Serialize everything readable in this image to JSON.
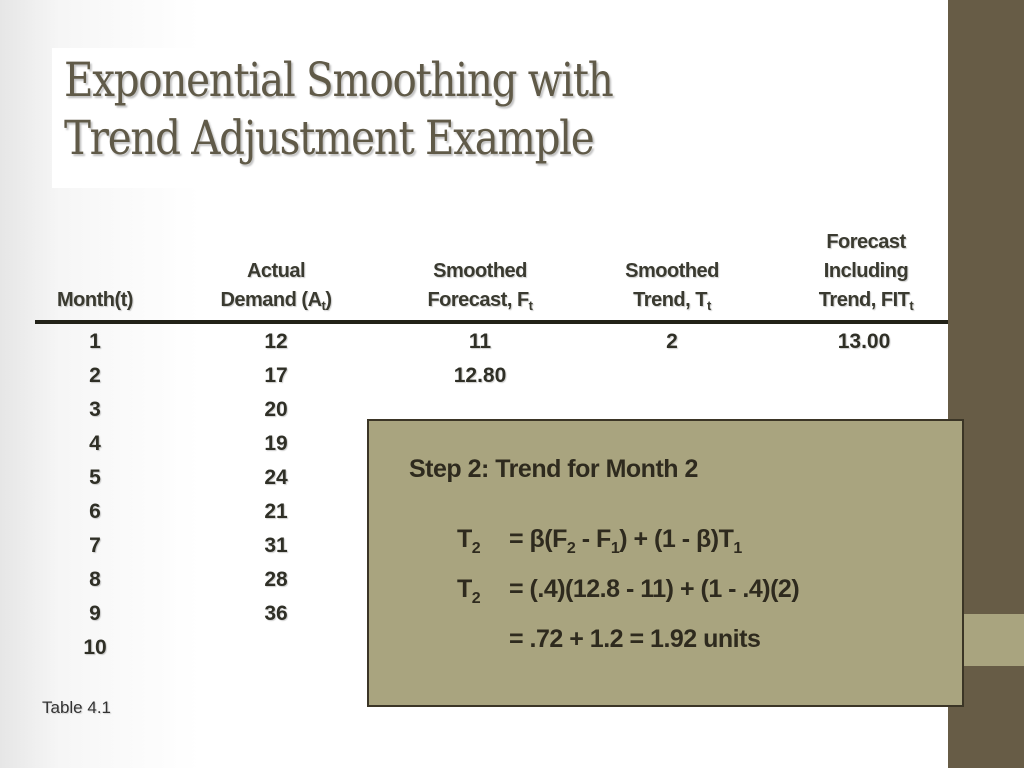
{
  "slide": {
    "title_line1": "Exponential Smoothing with",
    "title_line2": "Trend Adjustment Example",
    "caption": "Table 4.1",
    "colors": {
      "sidebar": "#675c46",
      "accent": "#a9a47f",
      "title": "#605a48"
    }
  },
  "table": {
    "headers": [
      {
        "lines": [
          "Month(t)"
        ]
      },
      {
        "lines": [
          "Actual",
          "Demand (A"
        ],
        "sub": "t",
        "after": ")"
      },
      {
        "lines": [
          "Smoothed",
          "Forecast, F"
        ],
        "sub": "t",
        "after": ""
      },
      {
        "lines": [
          "Smoothed",
          "Trend, T"
        ],
        "sub": "t",
        "after": ""
      },
      {
        "lines": [
          "Forecast",
          "Including",
          "Trend, FIT"
        ],
        "sub": "t",
        "after": ""
      }
    ],
    "rows": [
      {
        "month": "1",
        "demand": "12",
        "forecast": "11",
        "trend": "2",
        "fit": "13.00"
      },
      {
        "month": "2",
        "demand": "17",
        "forecast": "12.80",
        "trend": "",
        "fit": ""
      },
      {
        "month": "3",
        "demand": "20",
        "forecast": "",
        "trend": "",
        "fit": ""
      },
      {
        "month": "4",
        "demand": "19",
        "forecast": "",
        "trend": "",
        "fit": ""
      },
      {
        "month": "5",
        "demand": "24",
        "forecast": "",
        "trend": "",
        "fit": ""
      },
      {
        "month": "6",
        "demand": "21",
        "forecast": "",
        "trend": "",
        "fit": ""
      },
      {
        "month": "7",
        "demand": "31",
        "forecast": "",
        "trend": "",
        "fit": ""
      },
      {
        "month": "8",
        "demand": "28",
        "forecast": "",
        "trend": "",
        "fit": ""
      },
      {
        "month": "9",
        "demand": "36",
        "forecast": "",
        "trend": "",
        "fit": ""
      },
      {
        "month": "10",
        "demand": "",
        "forecast": "",
        "trend": "",
        "fit": ""
      }
    ]
  },
  "step_box": {
    "title": "Step 2: Trend for Month 2",
    "eq1": {
      "lhs": "T",
      "lhs_sub": "2",
      "parts": [
        "= β(F",
        "2",
        " - F",
        "1",
        ") + (1 - β)T",
        "1"
      ]
    },
    "eq2": {
      "lhs": "T",
      "lhs_sub": "2",
      "text": "= (.4)(12.8 - 11) + (1 - .4)(2)"
    },
    "eq3": {
      "text": "= .72 + 1.2 = 1.92 units"
    }
  }
}
